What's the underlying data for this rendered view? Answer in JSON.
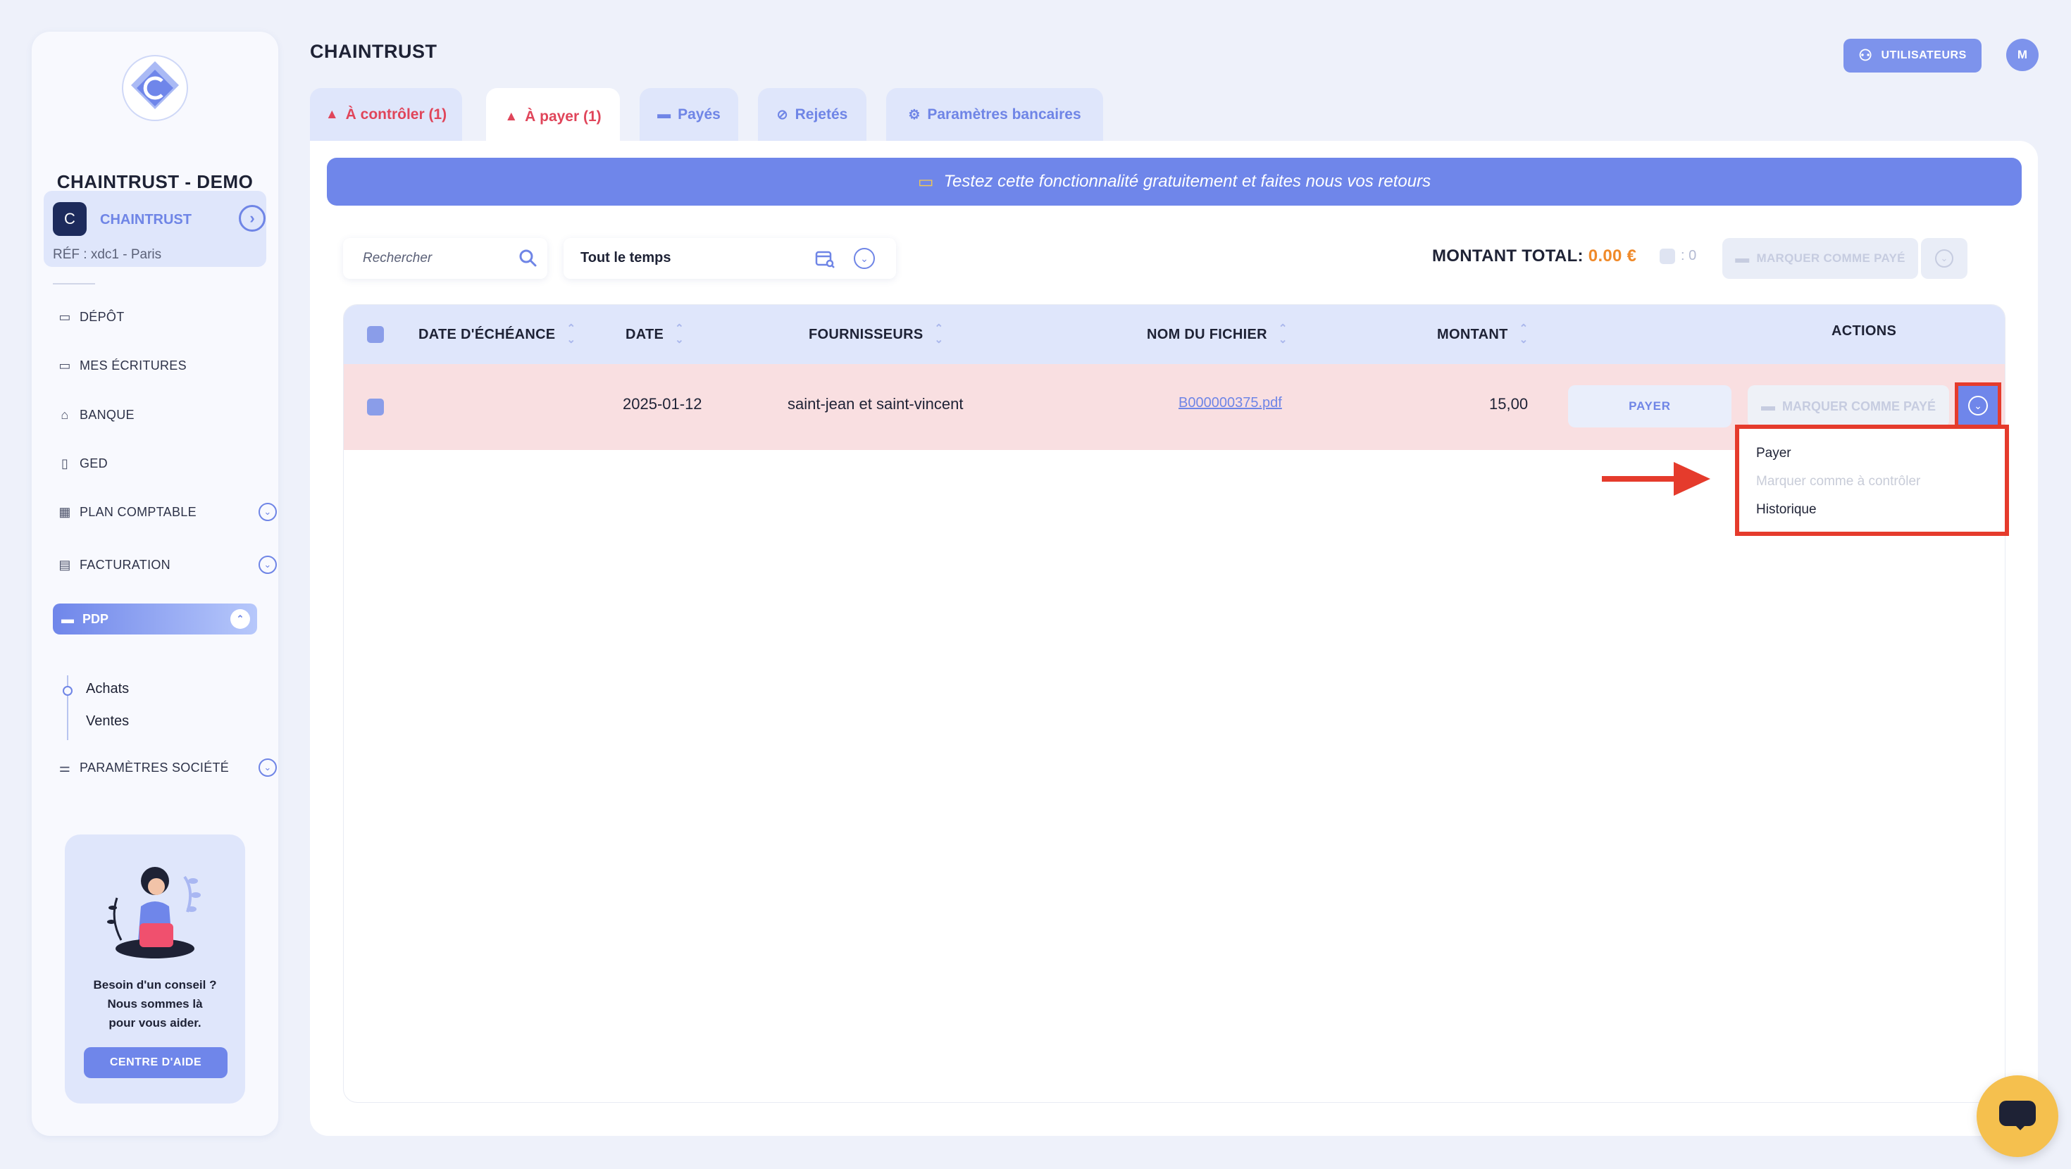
{
  "sidebar": {
    "company": "CHAINTRUST - DEMO",
    "org": {
      "icon_text": "C",
      "name": "CHAINTRUST",
      "ref": "RÉF : xdc1 - Paris"
    },
    "items": [
      {
        "label": "DÉPÔT",
        "icon": "folder-icon"
      },
      {
        "label": "MES ÉCRITURES",
        "icon": "folder-icon"
      },
      {
        "label": "BANQUE",
        "icon": "bank-icon"
      },
      {
        "label": "GED",
        "icon": "document-icon"
      },
      {
        "label": "PLAN COMPTABLE",
        "icon": "table-icon"
      },
      {
        "label": "FACTURATION",
        "icon": "invoice-icon"
      },
      {
        "label": "PDP",
        "icon": "card-icon"
      },
      {
        "label": "PARAMÈTRES SOCIÉTÉ",
        "icon": "sliders-icon"
      }
    ],
    "sub_items": [
      "Achats",
      "Ventes"
    ],
    "help": {
      "line1": "Besoin d'un conseil ?",
      "line2": "Nous sommes là",
      "line3": "pour vous aider.",
      "button": "CENTRE D'AIDE"
    }
  },
  "header": {
    "title": "CHAINTRUST",
    "users_button": "UTILISATEURS",
    "avatar": "M"
  },
  "tabs": [
    {
      "label": "À contrôler (1)"
    },
    {
      "label": "À payer (1)",
      "active": true
    },
    {
      "label": "Payés"
    },
    {
      "label": "Rejetés"
    },
    {
      "label": "Paramètres bancaires"
    }
  ],
  "banner": "Testez cette fonctionnalité gratuitement et faites nous vos retours",
  "toolbar": {
    "search_placeholder": "Rechercher",
    "period": "Tout le temps",
    "total_label": "MONTANT TOTAL:",
    "total_value": "0.00 €",
    "selected_count": ": 0",
    "mark_paid": "MARQUER COMME PAYÉ"
  },
  "table": {
    "columns": [
      "DATE D'ÉCHÉANCE",
      "DATE",
      "FOURNISSEURS",
      "NOM DU FICHIER",
      "MONTANT",
      "ACTIONS"
    ],
    "rows": [
      {
        "due_date": "",
        "date": "2025-01-12",
        "supplier": "saint-jean et saint-vincent",
        "file": "B000000375.pdf",
        "amount": "15,00",
        "pay_button": "PAYER",
        "mark_button": "MARQUER COMME PAYÉ"
      }
    ]
  },
  "dropdown": {
    "items": [
      {
        "label": "Payer",
        "disabled": false
      },
      {
        "label": "Marquer comme à contrôler",
        "disabled": true
      },
      {
        "label": "Historique",
        "disabled": false
      }
    ]
  },
  "colors": {
    "accent": "#6f86ea",
    "danger": "#e0455a",
    "highlight": "#e53b2c",
    "amount": "#f08a2a",
    "row_alert": "#f9dfe1"
  }
}
